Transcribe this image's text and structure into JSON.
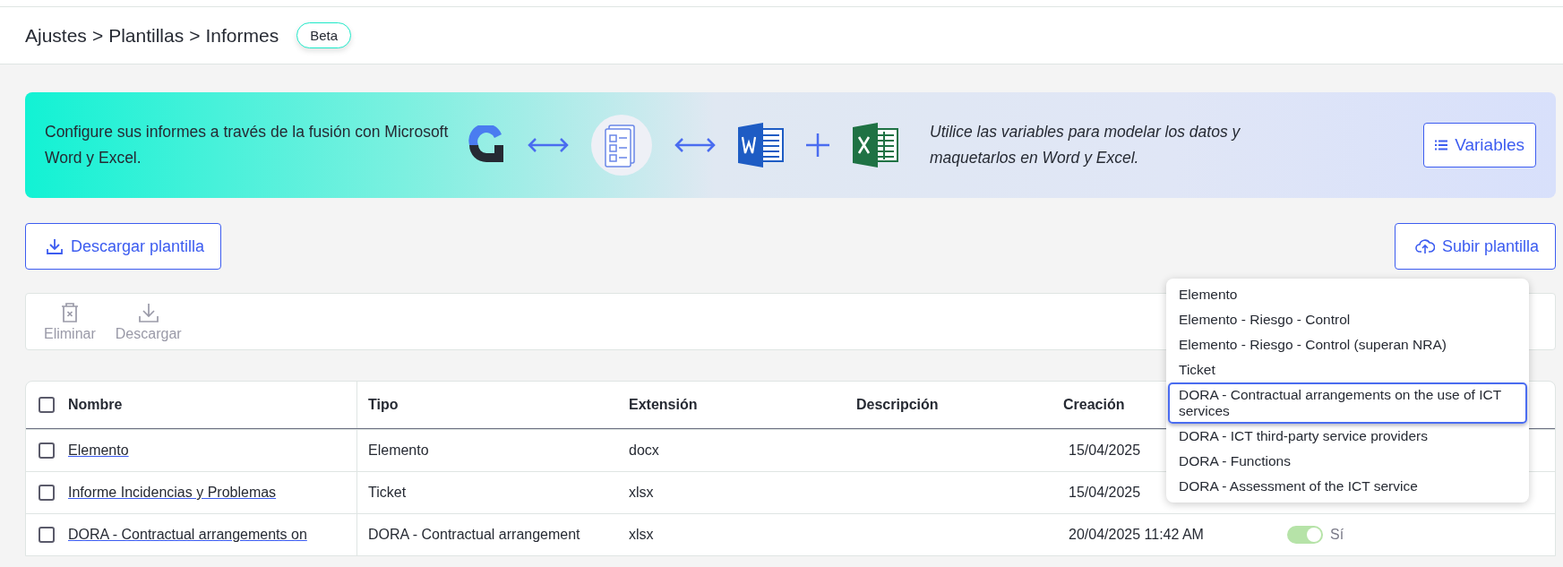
{
  "breadcrumb": [
    "Ajustes",
    "Plantillas",
    "Informes"
  ],
  "breadcrumb_separator": ">",
  "badge": "Beta",
  "banner": {
    "text_left": "Configure sus informes a través de la fusión con Microsoft Word y Excel.",
    "text_right": "Utilice las variables para modelar los datos y maquetarlos en Word y Excel.",
    "button": "Variables"
  },
  "actions": {
    "download_template": "Descargar plantilla",
    "upload_template": "Subir plantilla"
  },
  "toolbar": [
    {
      "label": "Eliminar",
      "kind": "delete",
      "disabled": true
    },
    {
      "label": "Descargar",
      "kind": "download",
      "disabled": true
    }
  ],
  "table": {
    "select_all_checked": false,
    "columns": [
      "Nombre",
      "Tipo",
      "Extensión",
      "Descripción",
      "Creación"
    ],
    "rows": [
      {
        "checked": false,
        "name": "Elemento",
        "type": "Elemento",
        "extension": "docx",
        "created": "15/04/2025"
      },
      {
        "checked": false,
        "name": "Informe Incidencias y Problemas",
        "type": "Ticket",
        "extension": "xlsx",
        "created": "15/04/2025"
      },
      {
        "checked": false,
        "name": "DORA - Contractual arrangements on",
        "type": "DORA - Contractual arrangement",
        "extension": "xlsx",
        "created": "20/04/2025 11:42 AM",
        "on": true,
        "on_label": "Sí"
      }
    ]
  },
  "dropdown": [
    {
      "label": "Elemento",
      "selected": false
    },
    {
      "label": "Elemento - Riesgo - Control",
      "selected": false
    },
    {
      "label": "Elemento - Riesgo - Control (superan NRA)",
      "selected": false
    },
    {
      "label": "Ticket",
      "selected": false
    },
    {
      "label": "DORA - Contractual arrangements on the use of ICT services",
      "selected": true
    },
    {
      "label": "DORA - ICT third-party service providers",
      "selected": false
    },
    {
      "label": "DORA - Functions",
      "selected": false
    },
    {
      "label": "DORA - Assessment of the ICT service",
      "selected": false
    }
  ]
}
